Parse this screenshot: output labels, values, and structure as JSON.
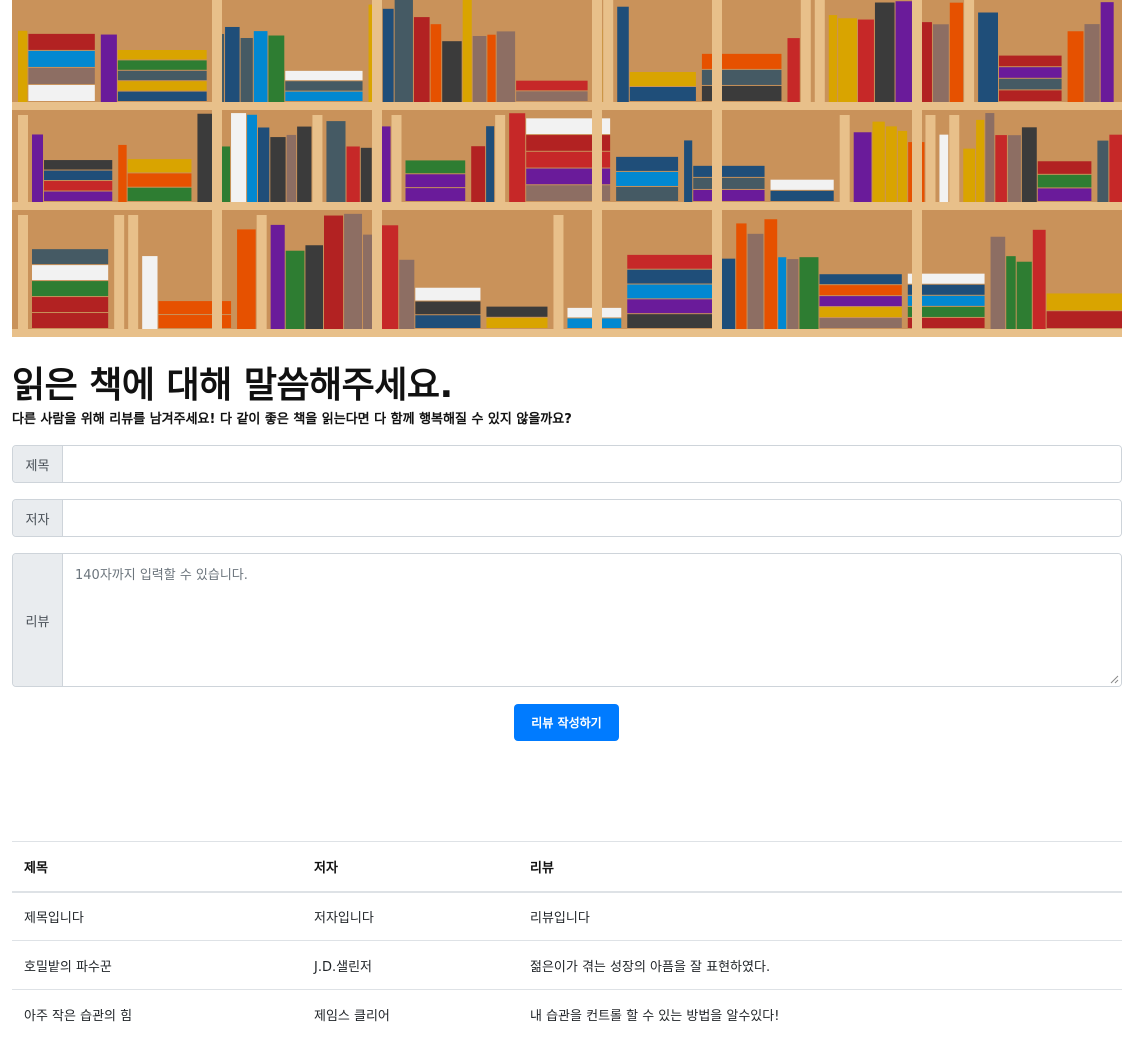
{
  "hero": {
    "image": "bookshelf-photo"
  },
  "header": {
    "title": "읽은 책에 대해 말씀해주세요.",
    "description": "다른 사람을 위해 리뷰를 남겨주세요! 다 같이 좋은 책을 읽는다면 다 함께 행복해질 수 있지 않을까요?"
  },
  "form": {
    "title_label": "제목",
    "title_value": "",
    "author_label": "저자",
    "author_value": "",
    "review_label": "리뷰",
    "review_placeholder": "140자까지 입력할 수 있습니다.",
    "submit_label": "리뷰 작성하기"
  },
  "table": {
    "headers": [
      "제목",
      "저자",
      "리뷰"
    ],
    "rows": [
      [
        "제목입니다",
        "저자입니다",
        "리뷰입니다"
      ],
      [
        "호밀밭의 파수꾼",
        "J.D.샐린저",
        "젊은이가 겪는 성장의 아픔을 잘 표현하였다."
      ],
      [
        "아주 작은 습관의 힘",
        "제임스 클리어",
        "내 습관을 컨트롤 할 수 있는 방법을 알수있다!"
      ]
    ]
  },
  "colors": {
    "accent": "#007bff",
    "shelf": "#e8c08a",
    "addon_bg": "#e9ecef"
  }
}
